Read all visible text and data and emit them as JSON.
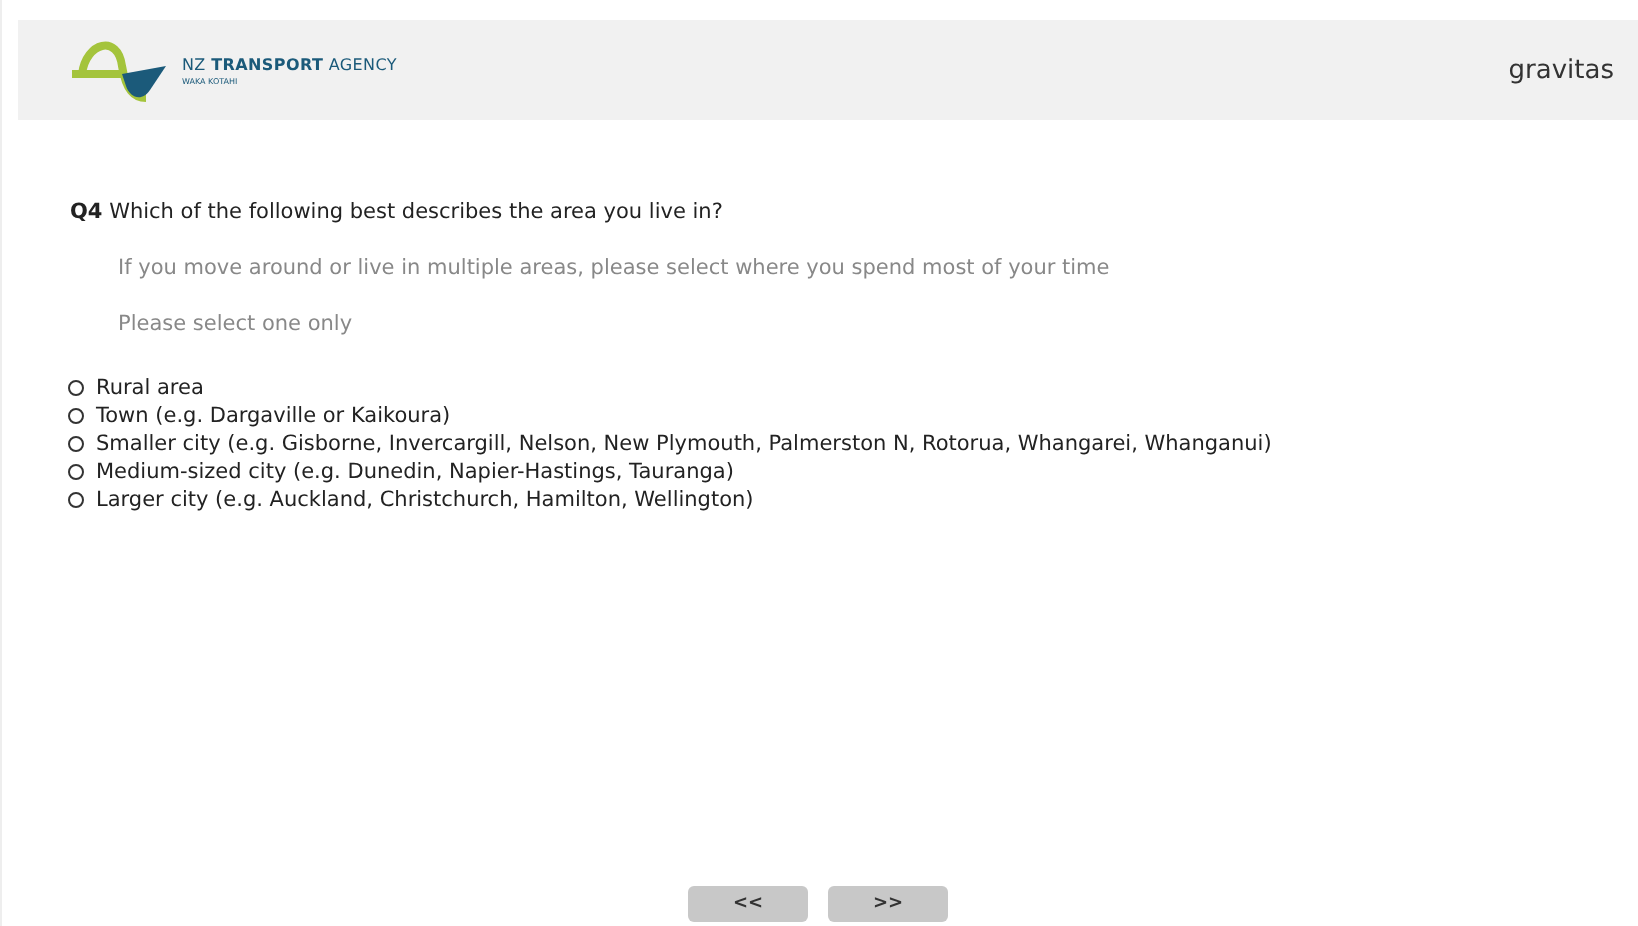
{
  "header": {
    "logo": {
      "name_light": "NZ ",
      "name_bold": "TRANSPORT",
      "name_rest": " AGENCY",
      "subtitle": "WAKA KOTAHI"
    },
    "brand": "gravitas"
  },
  "question": {
    "number": "Q4",
    "text": "Which of the following best describes the area you live in?",
    "hints": [
      "If you move around or live in multiple areas, please select where you spend most of your time",
      "Please select one only"
    ]
  },
  "options": [
    {
      "label": "Rural area",
      "selected": false
    },
    {
      "label": "Town (e.g. Dargaville or Kaikoura)",
      "selected": false
    },
    {
      "label": "Smaller city (e.g. Gisborne, Invercargill, Nelson, New Plymouth, Palmerston N, Rotorua, Whangarei, Whanganui)",
      "selected": false
    },
    {
      "label": "Medium-sized city (e.g. Dunedin, Napier-Hastings, Tauranga)",
      "selected": false
    },
    {
      "label": "Larger city (e.g. Auckland, Christchurch, Hamilton, Wellington)",
      "selected": false
    }
  ],
  "nav": {
    "back": "<<",
    "next": ">>"
  }
}
